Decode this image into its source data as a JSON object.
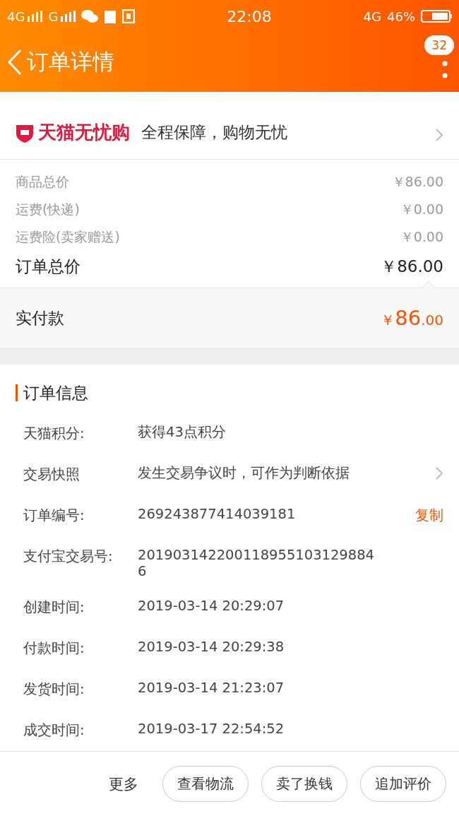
{
  "status_bar": {
    "left_signal_1": "4G",
    "left_signal_2": "G",
    "time": "22:08",
    "network": "4G",
    "battery": "46%"
  },
  "header": {
    "title": "订单详情",
    "badge": "32"
  },
  "guarantee": {
    "brand": "天猫无忧购",
    "text": "全程保障，购物无忧"
  },
  "price_rows": [
    {
      "label": "商品总价",
      "value": "￥86.00",
      "kind": "minor"
    },
    {
      "label": "运费(快递)",
      "value": "￥0.00",
      "kind": "minor"
    },
    {
      "label": "运费险(卖家赠送)",
      "value": "￥0.00",
      "kind": "minor"
    },
    {
      "label": "订单总价",
      "value": "￥86.00",
      "kind": "total"
    }
  ],
  "paid": {
    "label": "实付款",
    "symbol": "￥",
    "integer": "86",
    "decimal": ".00"
  },
  "order_info": {
    "title": "订单信息",
    "rows": [
      {
        "label": "天猫积分:",
        "value": "获得43点积分"
      },
      {
        "label": "交易快照",
        "value": "发生交易争议时，可作为判断依据",
        "kind": "link"
      },
      {
        "label": "订单编号:",
        "value": "269243877414039181",
        "action": "复制"
      },
      {
        "label": "支付宝交易号:",
        "value": "2019031422001189551031298846"
      },
      {
        "label": "创建时间:",
        "value": "2019-03-14 20:29:07"
      },
      {
        "label": "付款时间:",
        "value": "2019-03-14 20:29:38"
      },
      {
        "label": "发货时间:",
        "value": "2019-03-14 21:23:07"
      },
      {
        "label": "成交时间:",
        "value": "2019-03-17 22:54:52"
      }
    ]
  },
  "bottom_bar": {
    "more": "更多",
    "buttons": [
      "查看物流",
      "卖了换钱",
      "追加评价"
    ]
  }
}
